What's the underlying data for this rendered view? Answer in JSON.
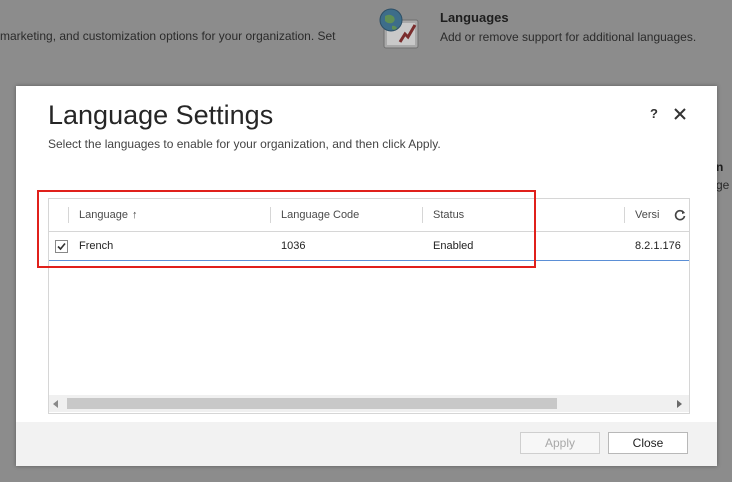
{
  "background": {
    "snippet_text": "marketing, and customization options for your organization. Set",
    "languages_title": "Languages",
    "languages_desc": "Add or remove support for additional languages.",
    "edge_title_fragment": "n",
    "edge_desc_fragment": "ge"
  },
  "dialog": {
    "title": "Language Settings",
    "subtitle": "Select the languages to enable for your organization, and then click Apply.",
    "help_label": "?",
    "grid": {
      "columns": [
        "Language",
        "Language Code",
        "Status",
        "Versi"
      ],
      "rows": [
        {
          "checked": true,
          "language": "French",
          "code": "1036",
          "status": "Enabled",
          "version": "8.2.1.176"
        }
      ]
    },
    "buttons": {
      "apply": "Apply",
      "close": "Close"
    }
  },
  "colors": {
    "highlight": "#e0201b",
    "row_border_accent": "#5b8fd6"
  }
}
